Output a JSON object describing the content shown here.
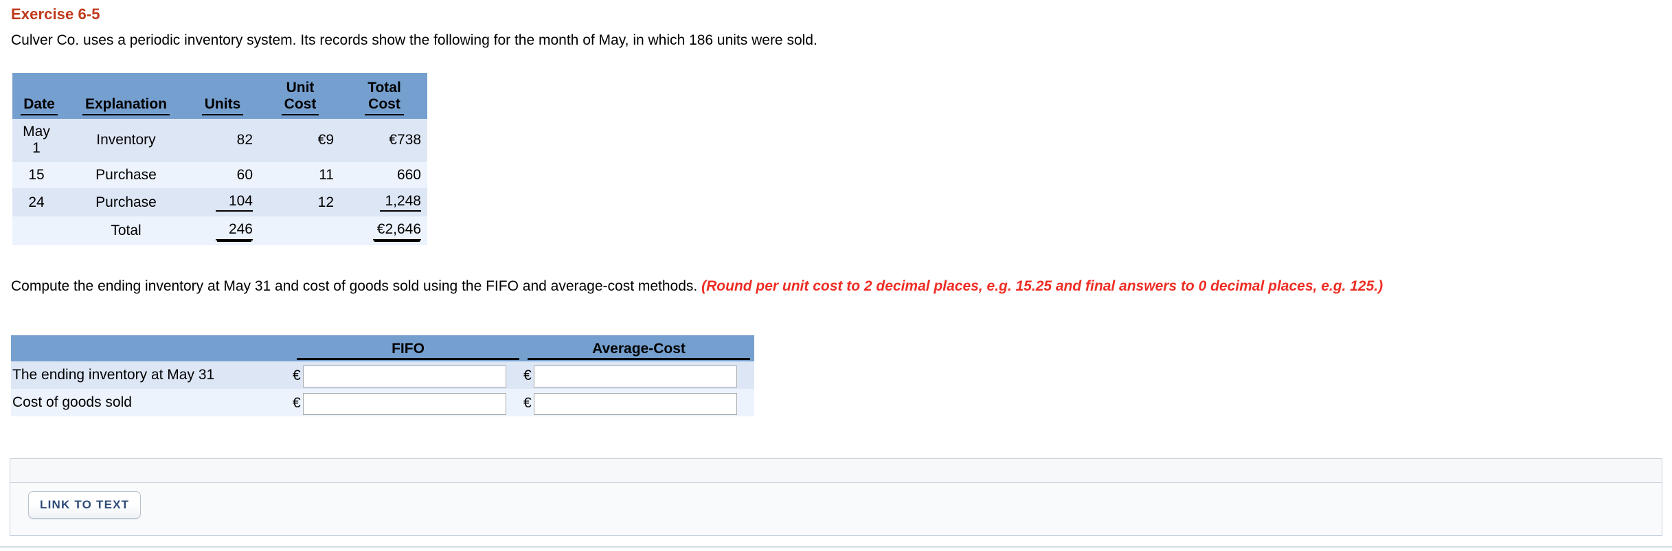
{
  "exercise": {
    "title": "Exercise 6-5",
    "intro": "Culver Co. uses a periodic inventory system. Its records show the following for the month of May, in which 186 units were sold."
  },
  "inventory_table": {
    "headers": [
      "Date",
      "Explanation",
      "Units",
      "Unit Cost",
      "Total Cost"
    ],
    "header_unit_cost_line1": "Unit",
    "header_unit_cost_line2": "Cost",
    "header_total_cost_line1": "Total",
    "header_total_cost_line2": "Cost",
    "rows": [
      {
        "date_line1": "May",
        "date_line2": "1",
        "explanation": "Inventory",
        "units": "82",
        "unit_cost": "€9",
        "total_cost": "€738"
      },
      {
        "date_line1": "15",
        "date_line2": "",
        "explanation": "Purchase",
        "units": "60",
        "unit_cost": "11",
        "total_cost": "660"
      },
      {
        "date_line1": "24",
        "date_line2": "",
        "explanation": "Purchase",
        "units": "104",
        "unit_cost": "12",
        "total_cost": "1,248"
      }
    ],
    "total_row": {
      "label": "Total",
      "units": "246",
      "unit_cost": "",
      "total_cost": "€2,646"
    }
  },
  "compute": {
    "black_text": "Compute the ending inventory at May 31 and cost of goods sold using the FIFO and average-cost methods. ",
    "red_text": "(Round per unit cost to 2 decimal places, e.g. 15.25 and final answers to 0 decimal places, e.g. 125.)"
  },
  "answer_table": {
    "headers": [
      "",
      "FIFO",
      "Average-Cost"
    ],
    "currency_symbol": "€",
    "rows": [
      {
        "label": "The ending inventory at May 31",
        "fifo_value": "",
        "fifo_placeholder": "",
        "avg_value": "",
        "avg_placeholder": ""
      },
      {
        "label": "Cost of goods sold",
        "fifo_value": "",
        "fifo_placeholder": "",
        "avg_value": "",
        "avg_placeholder": ""
      }
    ]
  },
  "footer": {
    "link_to_text_label": "LINK TO TEXT"
  },
  "colors": {
    "heading_red": "#c0391b",
    "note_red": "#ee2d24",
    "table_header_blue": "#759fce",
    "row_dark": "#dde6f5",
    "row_light": "#ecf3fd",
    "button_text": "#2e4b7a",
    "panel_border": "#c8d1de"
  }
}
